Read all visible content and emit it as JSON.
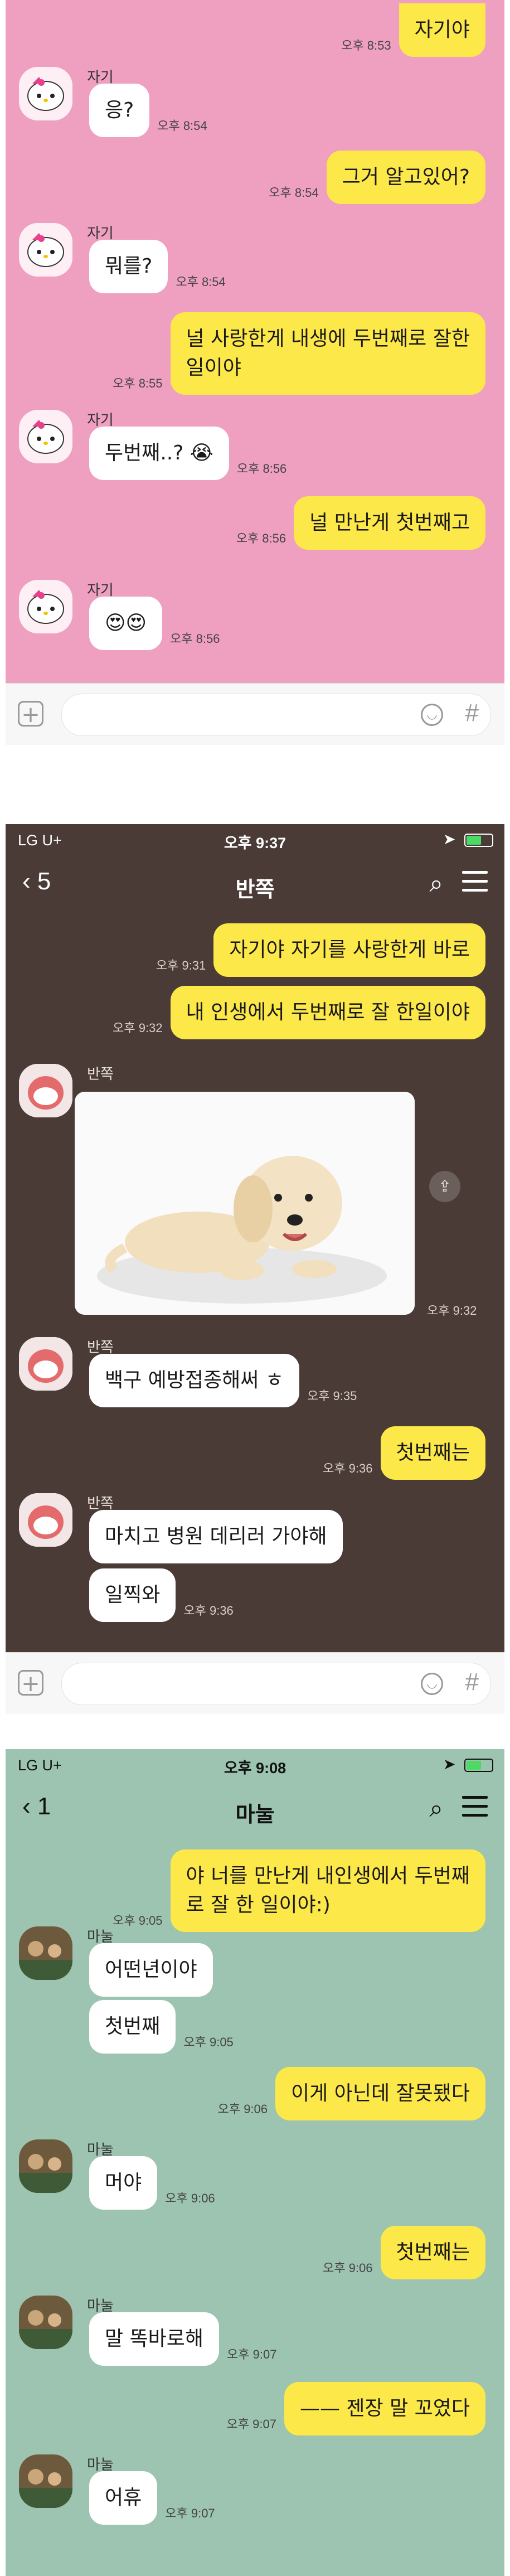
{
  "panel1": {
    "messages": [
      {
        "from": "me",
        "text": "자기야",
        "time": "오후 8:53"
      },
      {
        "from": "you",
        "name": "자기",
        "text": "응?",
        "time": "오후 8:54"
      },
      {
        "from": "me",
        "text": "그거 알고있어?",
        "time": "오후 8:54"
      },
      {
        "from": "you",
        "name": "자기",
        "text": "뭐를?",
        "time": "오후 8:54"
      },
      {
        "from": "me",
        "text": "널 사랑한게 내생에 두번째로 잘한\n일이야",
        "time": "오후 8:55"
      },
      {
        "from": "you",
        "name": "자기",
        "text": "두번째..? 😭",
        "time": "오후 8:56"
      },
      {
        "from": "me",
        "text": "널 만난게 첫번째고",
        "time": "오후 8:56"
      },
      {
        "from": "you",
        "name": "자기",
        "text": "😍😍",
        "time": "오후 8:56"
      }
    ]
  },
  "panel2": {
    "status": {
      "carrier": "LG U+",
      "clock": "오후 9:37"
    },
    "title": "반쪽",
    "back": "5",
    "messages": [
      {
        "from": "me",
        "text": "자기야 자기를 사랑한게 바로",
        "time": "오후 9:31"
      },
      {
        "from": "me",
        "text": "내 인생에서 두번째로 잘 한일이야",
        "time": "오후 9:32"
      },
      {
        "from": "you",
        "name": "반쪽",
        "photo": "puppy-photo",
        "time": "오후 9:32"
      },
      {
        "from": "you",
        "name": "반쪽",
        "text": "백구 예방접종해써 ㅎ",
        "time": "오후 9:35"
      },
      {
        "from": "me",
        "text": "첫번째는",
        "time": "오후 9:36"
      },
      {
        "from": "you",
        "name": "반쪽",
        "text": "마치고 병원 데리러 가야해",
        "time": ""
      },
      {
        "from": "you",
        "text": "일찍와",
        "time": "오후 9:36"
      }
    ]
  },
  "panel3": {
    "status": {
      "carrier": "LG U+",
      "clock": "오후 9:08"
    },
    "title": "마눌",
    "back": "1",
    "messages": [
      {
        "from": "me",
        "text": "야 너를 만난게 내인생에서 두번째\n로 잘 한 일이야:)",
        "time": "오후 9:05"
      },
      {
        "from": "you",
        "name": "마눌",
        "text": "어떤년이야",
        "time": ""
      },
      {
        "from": "you",
        "text": "첫번째",
        "time": "오후 9:05"
      },
      {
        "from": "me",
        "text": "이게 아닌데 잘못됐다",
        "time": "오후 9:06"
      },
      {
        "from": "you",
        "name": "마눌",
        "text": "머야",
        "time": "오후 9:06"
      },
      {
        "from": "me",
        "text": "첫번째는",
        "time": "오후 9:06"
      },
      {
        "from": "you",
        "name": "마눌",
        "text": "말 똑바로해",
        "time": "오후 9:07"
      },
      {
        "from": "me",
        "text": "—— 젠장 말 꼬였다",
        "time": "오후 9:07"
      },
      {
        "from": "you",
        "name": "마눌",
        "text": "어휴",
        "time": "오후 9:07"
      }
    ]
  },
  "colors": {
    "pink": "#ef9fc0",
    "brown": "#4a3b37",
    "mint": "#9cc4b1",
    "yellow": "#fde84a"
  }
}
